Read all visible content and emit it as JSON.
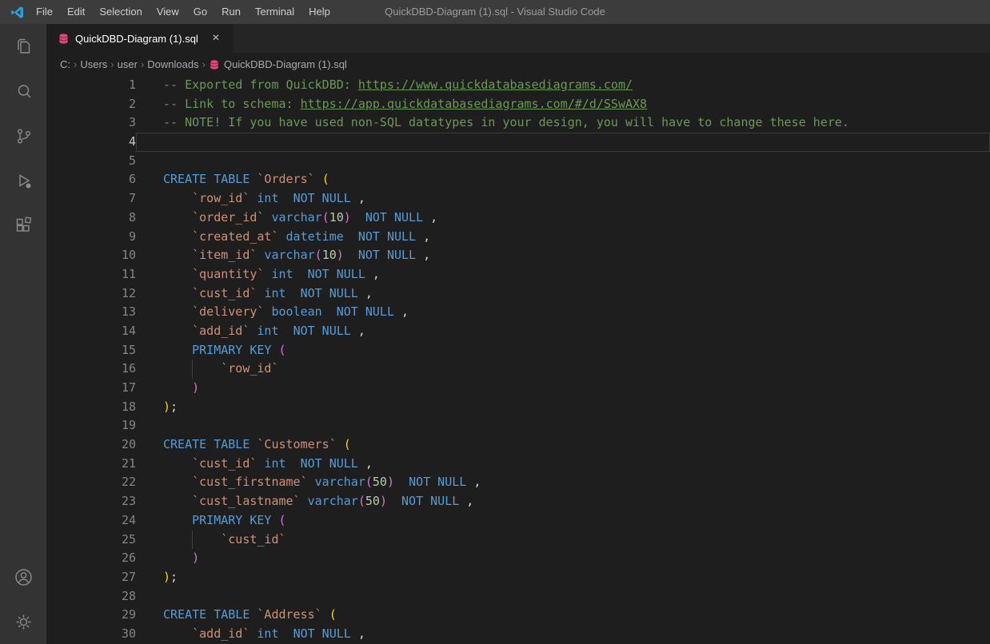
{
  "title_bar": {
    "menus": [
      "File",
      "Edit",
      "Selection",
      "View",
      "Go",
      "Run",
      "Terminal",
      "Help"
    ],
    "title": "QuickDBD-Diagram (1).sql - Visual Studio Code"
  },
  "activity_bar": {
    "top_icons": [
      "explorer-icon",
      "search-icon",
      "source-control-icon",
      "run-debug-icon",
      "extensions-icon"
    ],
    "bottom_icons": [
      "account-icon",
      "settings-gear-icon"
    ]
  },
  "tab": {
    "label": "QuickDBD-Diagram (1).sql",
    "close": "×",
    "icon": "database-icon"
  },
  "breadcrumbs": {
    "path": [
      "C:",
      "Users",
      "user",
      "Downloads"
    ],
    "separator": "›",
    "file": "QuickDBD-Diagram (1).sql"
  },
  "colors": {
    "comment": "#6a9955",
    "keyword": "#569cd6",
    "string": "#ce9178",
    "number": "#b5cea8",
    "bracket_level1": "#ffd700",
    "bracket_level2": "#da70d6",
    "sql_file_icon": "#e5447d"
  },
  "editor": {
    "active_line": 4,
    "lines": [
      {
        "n": 1,
        "segs": [
          [
            "c",
            "-- Exported from QuickDBD: "
          ],
          [
            "lnk",
            "https://www.quickdatabasediagrams.com/"
          ]
        ]
      },
      {
        "n": 2,
        "segs": [
          [
            "c",
            "-- Link to schema: "
          ],
          [
            "lnk",
            "https://app.quickdatabasediagrams.com/#/d/SSwAX8"
          ]
        ]
      },
      {
        "n": 3,
        "segs": [
          [
            "c",
            "-- NOTE! If you have used non-SQL datatypes in your design, you will have to change these here."
          ]
        ]
      },
      {
        "n": 4,
        "active": true,
        "segs": []
      },
      {
        "n": 5,
        "segs": []
      },
      {
        "n": 6,
        "segs": [
          [
            "k",
            "CREATE TABLE"
          ],
          [
            "p",
            " "
          ],
          [
            "s",
            "`Orders`"
          ],
          [
            "p",
            " "
          ],
          [
            "b1",
            "("
          ]
        ]
      },
      {
        "n": 7,
        "segs": [
          [
            "p",
            "    "
          ],
          [
            "s",
            "`row_id`"
          ],
          [
            "p",
            " "
          ],
          [
            "t",
            "int"
          ],
          [
            "p",
            "  "
          ],
          [
            "k",
            "NOT NULL"
          ],
          [
            "p",
            " ,"
          ]
        ]
      },
      {
        "n": 8,
        "segs": [
          [
            "p",
            "    "
          ],
          [
            "s",
            "`order_id`"
          ],
          [
            "p",
            " "
          ],
          [
            "t",
            "varchar"
          ],
          [
            "b2",
            "("
          ],
          [
            "n",
            "10"
          ],
          [
            "b2",
            ")"
          ],
          [
            "p",
            "  "
          ],
          [
            "k",
            "NOT NULL"
          ],
          [
            "p",
            " ,"
          ]
        ]
      },
      {
        "n": 9,
        "segs": [
          [
            "p",
            "    "
          ],
          [
            "s",
            "`created_at`"
          ],
          [
            "p",
            " "
          ],
          [
            "t",
            "datetime"
          ],
          [
            "p",
            "  "
          ],
          [
            "k",
            "NOT NULL"
          ],
          [
            "p",
            " ,"
          ]
        ]
      },
      {
        "n": 10,
        "segs": [
          [
            "p",
            "    "
          ],
          [
            "s",
            "`item_id`"
          ],
          [
            "p",
            " "
          ],
          [
            "t",
            "varchar"
          ],
          [
            "b2",
            "("
          ],
          [
            "n",
            "10"
          ],
          [
            "b2",
            ")"
          ],
          [
            "p",
            "  "
          ],
          [
            "k",
            "NOT NULL"
          ],
          [
            "p",
            " ,"
          ]
        ]
      },
      {
        "n": 11,
        "segs": [
          [
            "p",
            "    "
          ],
          [
            "s",
            "`quantity`"
          ],
          [
            "p",
            " "
          ],
          [
            "t",
            "int"
          ],
          [
            "p",
            "  "
          ],
          [
            "k",
            "NOT NULL"
          ],
          [
            "p",
            " ,"
          ]
        ]
      },
      {
        "n": 12,
        "segs": [
          [
            "p",
            "    "
          ],
          [
            "s",
            "`cust_id`"
          ],
          [
            "p",
            " "
          ],
          [
            "t",
            "int"
          ],
          [
            "p",
            "  "
          ],
          [
            "k",
            "NOT NULL"
          ],
          [
            "p",
            " ,"
          ]
        ]
      },
      {
        "n": 13,
        "segs": [
          [
            "p",
            "    "
          ],
          [
            "s",
            "`delivery`"
          ],
          [
            "p",
            " "
          ],
          [
            "t",
            "boolean"
          ],
          [
            "p",
            "  "
          ],
          [
            "k",
            "NOT NULL"
          ],
          [
            "p",
            " ,"
          ]
        ]
      },
      {
        "n": 14,
        "segs": [
          [
            "p",
            "    "
          ],
          [
            "s",
            "`add_id`"
          ],
          [
            "p",
            " "
          ],
          [
            "t",
            "int"
          ],
          [
            "p",
            "  "
          ],
          [
            "k",
            "NOT NULL"
          ],
          [
            "p",
            " ,"
          ]
        ]
      },
      {
        "n": 15,
        "segs": [
          [
            "p",
            "    "
          ],
          [
            "k",
            "PRIMARY KEY"
          ],
          [
            "p",
            " "
          ],
          [
            "b2",
            "("
          ]
        ]
      },
      {
        "n": 16,
        "guides": [
          4
        ],
        "segs": [
          [
            "p",
            "        "
          ],
          [
            "s",
            "`row_id`"
          ]
        ]
      },
      {
        "n": 17,
        "segs": [
          [
            "p",
            "    "
          ],
          [
            "b2",
            ")"
          ]
        ]
      },
      {
        "n": 18,
        "segs": [
          [
            "b1",
            ")"
          ],
          [
            "p",
            ";"
          ]
        ]
      },
      {
        "n": 19,
        "segs": []
      },
      {
        "n": 20,
        "segs": [
          [
            "k",
            "CREATE TABLE"
          ],
          [
            "p",
            " "
          ],
          [
            "s",
            "`Customers`"
          ],
          [
            "p",
            " "
          ],
          [
            "b1",
            "("
          ]
        ]
      },
      {
        "n": 21,
        "segs": [
          [
            "p",
            "    "
          ],
          [
            "s",
            "`cust_id`"
          ],
          [
            "p",
            " "
          ],
          [
            "t",
            "int"
          ],
          [
            "p",
            "  "
          ],
          [
            "k",
            "NOT NULL"
          ],
          [
            "p",
            " ,"
          ]
        ]
      },
      {
        "n": 22,
        "segs": [
          [
            "p",
            "    "
          ],
          [
            "s",
            "`cust_firstname`"
          ],
          [
            "p",
            " "
          ],
          [
            "t",
            "varchar"
          ],
          [
            "b2",
            "("
          ],
          [
            "n",
            "50"
          ],
          [
            "b2",
            ")"
          ],
          [
            "p",
            "  "
          ],
          [
            "k",
            "NOT NULL"
          ],
          [
            "p",
            " ,"
          ]
        ]
      },
      {
        "n": 23,
        "segs": [
          [
            "p",
            "    "
          ],
          [
            "s",
            "`cust_lastname`"
          ],
          [
            "p",
            " "
          ],
          [
            "t",
            "varchar"
          ],
          [
            "b2",
            "("
          ],
          [
            "n",
            "50"
          ],
          [
            "b2",
            ")"
          ],
          [
            "p",
            "  "
          ],
          [
            "k",
            "NOT NULL"
          ],
          [
            "p",
            " ,"
          ]
        ]
      },
      {
        "n": 24,
        "segs": [
          [
            "p",
            "    "
          ],
          [
            "k",
            "PRIMARY KEY"
          ],
          [
            "p",
            " "
          ],
          [
            "b2",
            "("
          ]
        ]
      },
      {
        "n": 25,
        "guides": [
          4
        ],
        "segs": [
          [
            "p",
            "        "
          ],
          [
            "s",
            "`cust_id`"
          ]
        ]
      },
      {
        "n": 26,
        "segs": [
          [
            "p",
            "    "
          ],
          [
            "b2",
            ")"
          ]
        ]
      },
      {
        "n": 27,
        "segs": [
          [
            "b1",
            ")"
          ],
          [
            "p",
            ";"
          ]
        ]
      },
      {
        "n": 28,
        "segs": []
      },
      {
        "n": 29,
        "segs": [
          [
            "k",
            "CREATE TABLE"
          ],
          [
            "p",
            " "
          ],
          [
            "s",
            "`Address`"
          ],
          [
            "p",
            " "
          ],
          [
            "b1",
            "("
          ]
        ]
      },
      {
        "n": 30,
        "segs": [
          [
            "p",
            "    "
          ],
          [
            "s",
            "`add_id`"
          ],
          [
            "p",
            " "
          ],
          [
            "t",
            "int"
          ],
          [
            "p",
            "  "
          ],
          [
            "k",
            "NOT NULL"
          ],
          [
            "p",
            " ,"
          ]
        ]
      }
    ]
  }
}
